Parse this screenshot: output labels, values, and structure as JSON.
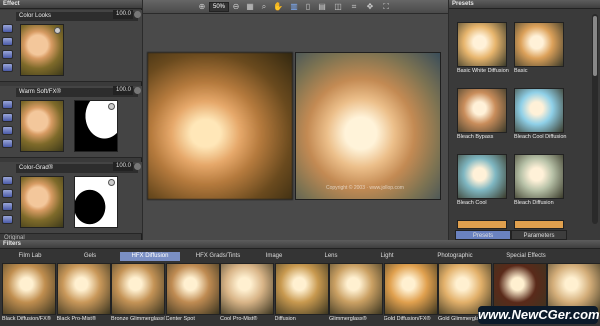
{
  "effect": {
    "header": "Effect",
    "layers": [
      {
        "title": "Color Looks",
        "value": "100.0"
      },
      {
        "title": "Warm Soft/FX®",
        "value": "100.0"
      },
      {
        "title": "Color-Grad®",
        "value": "100.0"
      }
    ],
    "more_label": "Original"
  },
  "viewer": {
    "zoom": "50%",
    "copyright": "Copyright © 2003 · www.jollop.com"
  },
  "presets": {
    "header": "Presets",
    "items": [
      {
        "label": "Basic White Diffusion",
        "color": "#e7b56d"
      },
      {
        "label": "Basic",
        "color": "#dca15a"
      },
      {
        "label": "Bleach Bypass",
        "color": "#c98d5b"
      },
      {
        "label": "Bleach Cool Diffusion",
        "color": "#8fd0e8"
      },
      {
        "label": "Bleach Cool",
        "color": "#7fb7c2"
      },
      {
        "label": "Bleach Diffusion",
        "color": "#b8c2a8"
      }
    ],
    "tabs": [
      "Presets",
      "Parameters"
    ]
  },
  "filters": {
    "header": "Filters",
    "tabs": [
      "Film Lab",
      "Gels",
      "HFX Diffusion",
      "HFX Grads/Tints",
      "Image",
      "Lens",
      "Light",
      "Photographic",
      "Special Effects"
    ],
    "active_tab": "HFX Diffusion",
    "items": [
      {
        "label": "Black Diffusion/FX®",
        "color": "#c08e4f"
      },
      {
        "label": "Black Pro-Mist®",
        "color": "#c9985a"
      },
      {
        "label": "Bronze Glimmerglass®",
        "color": "#c49356"
      },
      {
        "label": "Center Spot",
        "color": "#bf8b52"
      },
      {
        "label": "Cool Pro-Mist®",
        "color": "#d8b487"
      },
      {
        "label": "Diffusion",
        "color": "#c8994f"
      },
      {
        "label": "Glimmerglass®",
        "color": "#caa063"
      },
      {
        "label": "Gold Diffusion/FX®",
        "color": "#e0a04e"
      },
      {
        "label": "Gold Glimmerglass",
        "color": "#e2b06a"
      },
      {
        "label": "",
        "color": "#5a2a1a"
      },
      {
        "label": "",
        "color": "#d3ad79"
      }
    ]
  },
  "watermark": "www.NewCGer.com"
}
